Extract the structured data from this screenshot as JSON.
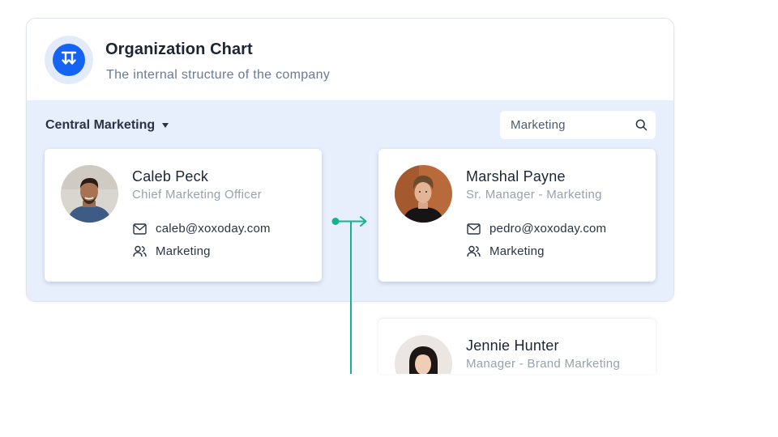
{
  "header": {
    "title": "Organization Chart",
    "subtitle": "The internal structure of the company",
    "logo_icon": "org-chart-icon"
  },
  "filters": {
    "department": "Central Marketing",
    "search_value": "Marketing"
  },
  "cards": [
    {
      "name": "Caleb Peck",
      "role": "Chief Marketing Officer",
      "email": "caleb@xoxoday.com",
      "team": "Marketing"
    },
    {
      "name": "Marshal Payne",
      "role": "Sr. Manager - Marketing",
      "email": "pedro@xoxoday.com",
      "team": "Marketing"
    },
    {
      "name": "Jennie Hunter",
      "role": "Manager - Brand Marketing"
    }
  ],
  "colors": {
    "accent": "#1463f3",
    "connector": "#14b38c",
    "panel_body": "#e8effc"
  }
}
